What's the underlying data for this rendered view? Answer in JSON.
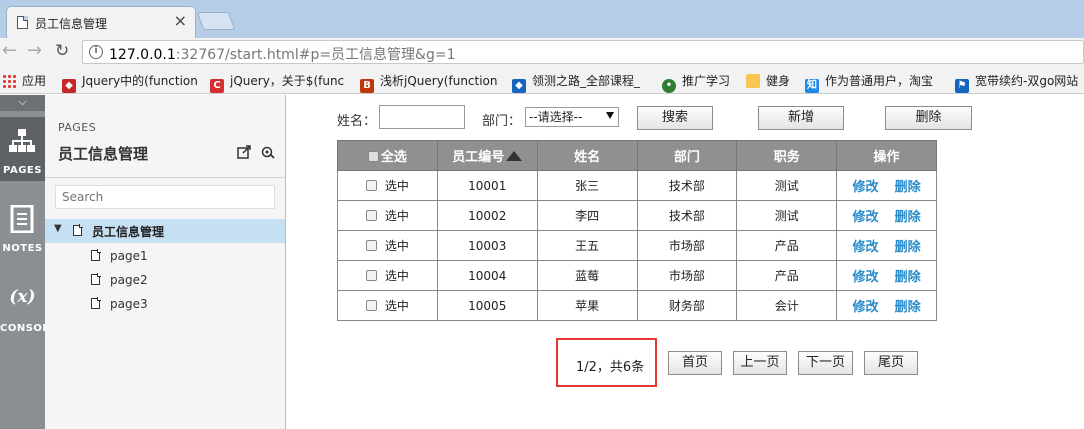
{
  "browser": {
    "tab_title": "员工信息管理",
    "tab_close": "×",
    "url_host": "127.0.0.1",
    "url_rest": ":32767/start.html#p=员工信息管理&g=1"
  },
  "bookmarks": [
    {
      "label": "应用",
      "icon": "apps-grid-icon"
    },
    {
      "label": "Jquery中的(function",
      "icon": "shield-icon",
      "color": "#c62828"
    },
    {
      "label": "jQuery，关于$(func",
      "icon": "csdn-c-icon",
      "color": "#d32f2f"
    },
    {
      "label": "浅析jQuery(function",
      "icon": "b-logo-icon",
      "color": "#bf360c"
    },
    {
      "label": "领测之路_全部课程_",
      "icon": "diamond-icon",
      "color": "#1565c0"
    },
    {
      "label": "推广学习",
      "icon": "wechat-icon",
      "color": "#2e7d32"
    },
    {
      "label": "健身",
      "icon": "folder-icon",
      "color": "#f9c74f"
    },
    {
      "label": "作为普通用户，淘宝",
      "icon": "zhihu-icon",
      "color": "#1e88e5"
    },
    {
      "label": "宽带续约-双go网站",
      "icon": "flag-icon",
      "color": "#1565c0"
    }
  ],
  "rail": {
    "pages": "PAGES",
    "notes": "NOTES",
    "console": "CONSOL",
    "console_symbol": "(x)"
  },
  "panel": {
    "caption": "PAGES",
    "title": "员工信息管理",
    "search_placeholder": "Search",
    "root": "员工信息管理",
    "pages": [
      "page1",
      "page2",
      "page3"
    ]
  },
  "form": {
    "name_label": "姓名：",
    "dept_label": "部门：",
    "dept_selected": "--请选择--",
    "search_button": "搜索",
    "add_button": "新增",
    "delete_button": "删除"
  },
  "table": {
    "headers": [
      "全选",
      "员工编号",
      "姓名",
      "部门",
      "职务",
      "操作"
    ],
    "select_label": "选中",
    "edit_label": "修改",
    "delete_label": "删除",
    "rows": [
      {
        "id": "10001",
        "name": "张三",
        "dept": "技术部",
        "title": "测试"
      },
      {
        "id": "10002",
        "name": "李四",
        "dept": "技术部",
        "title": "测试"
      },
      {
        "id": "10003",
        "name": "王五",
        "dept": "市场部",
        "title": "产品"
      },
      {
        "id": "10004",
        "name": "蓝莓",
        "dept": "市场部",
        "title": "产品"
      },
      {
        "id": "10005",
        "name": "苹果",
        "dept": "财务部",
        "title": "会计"
      }
    ]
  },
  "pager": {
    "info": "1/2，共6条",
    "first": "首页",
    "prev": "上一页",
    "next": "下一页",
    "last": "尾页"
  }
}
